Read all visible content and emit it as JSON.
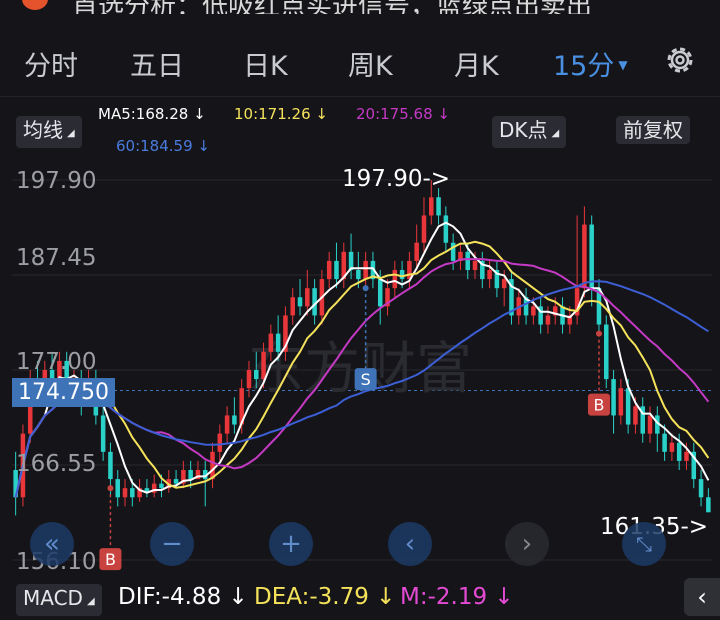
{
  "header": {
    "title": "首选分析：低吸红点买进信号，蓝绿点出卖出"
  },
  "tabs": [
    {
      "label": "分时"
    },
    {
      "label": "五日"
    },
    {
      "label": "日K"
    },
    {
      "label": "周K"
    },
    {
      "label": "月K"
    },
    {
      "label": "15分"
    }
  ],
  "indicator_bar": {
    "ma_selector": "均线",
    "ma5": "MA5:168.28",
    "ma10": "10:171.26",
    "ma20": "20:175.68",
    "ma60": "60:184.59",
    "arrow": "↓",
    "dk_selector": "DK点",
    "adjust": "前复权"
  },
  "colors": {
    "up": "#e8363b",
    "down": "#2ad1c9",
    "ma5": "#ffffff",
    "ma10": "#f5e25b",
    "ma20": "#c43ac4",
    "ma60": "#3c5fd6",
    "accent": "#4a90e2",
    "dif": "#ffffff",
    "dea": "#f5e25b",
    "m": "#e44bd4"
  },
  "y_axis": {
    "ticks": [
      "197.90",
      "187.45",
      "177.00",
      "166.55",
      "156.10"
    ]
  },
  "current_price_label": "174.750",
  "annotations": {
    "high": "197.90->",
    "low": "161.35->",
    "signal_s": "S",
    "signal_b": "B"
  },
  "watermark": "东方财富",
  "macd": {
    "selector": "MACD",
    "dif": "DIF:-4.88",
    "dea": "DEA:-3.79",
    "m": "M:-2.19",
    "arrow": "↓"
  },
  "chart_data": {
    "type": "candlestick",
    "ylim": [
      156.1,
      197.9
    ],
    "candles": [
      [
        166,
        163,
        168,
        161
      ],
      [
        163,
        170,
        171,
        162
      ],
      [
        170,
        176,
        177,
        169
      ],
      [
        176,
        174,
        178,
        173
      ],
      [
        174,
        177,
        178,
        173
      ],
      [
        177,
        176,
        179,
        175
      ],
      [
        176,
        178,
        179,
        175
      ],
      [
        178,
        175,
        179,
        174
      ],
      [
        175,
        176,
        177,
        173
      ],
      [
        176,
        174,
        177,
        172
      ],
      [
        174,
        176,
        177,
        173
      ],
      [
        176,
        172,
        177,
        171
      ],
      [
        172,
        168,
        173,
        167
      ],
      [
        168,
        165,
        169,
        163
      ],
      [
        165,
        163,
        166,
        162
      ],
      [
        163,
        164,
        165,
        162
      ],
      [
        164,
        163,
        165,
        162
      ],
      [
        163,
        164,
        165,
        162.5
      ],
      [
        164,
        163.5,
        165,
        163
      ],
      [
        163.5,
        164.5,
        165.5,
        163
      ],
      [
        164.5,
        164,
        165.5,
        163
      ],
      [
        164,
        165,
        166,
        163.5
      ],
      [
        165,
        164.5,
        166,
        164
      ],
      [
        164.5,
        166,
        167,
        164
      ],
      [
        166,
        165,
        167,
        164
      ],
      [
        165,
        166,
        167,
        165
      ],
      [
        166,
        165,
        167,
        162
      ],
      [
        165,
        168,
        169,
        164
      ],
      [
        168,
        170,
        171,
        167
      ],
      [
        170,
        172,
        173,
        169
      ],
      [
        172,
        171,
        174,
        170
      ],
      [
        171,
        175,
        176,
        170
      ],
      [
        175,
        177,
        178,
        174
      ],
      [
        177,
        176,
        179,
        175
      ],
      [
        176,
        179,
        180,
        175
      ],
      [
        179,
        181,
        182,
        178
      ],
      [
        181,
        179,
        183,
        178
      ],
      [
        179,
        183,
        184,
        178
      ],
      [
        183,
        185,
        186,
        182
      ],
      [
        185,
        184,
        187,
        183
      ],
      [
        184,
        186,
        188,
        183
      ],
      [
        186,
        183,
        187,
        182
      ],
      [
        183,
        187,
        188,
        182
      ],
      [
        187,
        189,
        190,
        186
      ],
      [
        189,
        187,
        191,
        186
      ],
      [
        187,
        190,
        191,
        186
      ],
      [
        190,
        188,
        192,
        187
      ],
      [
        188,
        187,
        190,
        186
      ],
      [
        187,
        189,
        190,
        186
      ],
      [
        189,
        187,
        190,
        186
      ],
      [
        187,
        184,
        188,
        182
      ],
      [
        184,
        186,
        187,
        183
      ],
      [
        186,
        188,
        189,
        185
      ],
      [
        188,
        187,
        189,
        186
      ],
      [
        187,
        189,
        190,
        186
      ],
      [
        189,
        191,
        193,
        188
      ],
      [
        191,
        194,
        196,
        190
      ],
      [
        194,
        196,
        197.9,
        193
      ],
      [
        196,
        194,
        197,
        193
      ],
      [
        194,
        191,
        195,
        190
      ],
      [
        191,
        189,
        192,
        188
      ],
      [
        189,
        190,
        191,
        188
      ],
      [
        190,
        188,
        191,
        187
      ],
      [
        188,
        189,
        190,
        187
      ],
      [
        189,
        187,
        190,
        186
      ],
      [
        187,
        188,
        189,
        186
      ],
      [
        188,
        186,
        189,
        185
      ],
      [
        186,
        187,
        188,
        184
      ],
      [
        187,
        183,
        188,
        182
      ],
      [
        183,
        185,
        186,
        182
      ],
      [
        185,
        183,
        186,
        182
      ],
      [
        183,
        184,
        185,
        182
      ],
      [
        184,
        182,
        185,
        181
      ],
      [
        182,
        183,
        184,
        181
      ],
      [
        183,
        184,
        185,
        182
      ],
      [
        184,
        182,
        185,
        181
      ],
      [
        182,
        183,
        184,
        181
      ],
      [
        183,
        186,
        194,
        182
      ],
      [
        186,
        193,
        195,
        185
      ],
      [
        193,
        186,
        194,
        184
      ],
      [
        186,
        182,
        187,
        181
      ],
      [
        182,
        176,
        183,
        175
      ],
      [
        176,
        172,
        177,
        170
      ],
      [
        172,
        175,
        176,
        171
      ],
      [
        175,
        171,
        176,
        170
      ],
      [
        171,
        173,
        174,
        170
      ],
      [
        173,
        170,
        174,
        169
      ],
      [
        170,
        172,
        173,
        169
      ],
      [
        172,
        170,
        173,
        168
      ],
      [
        170,
        168,
        171,
        167
      ],
      [
        168,
        169,
        170,
        167
      ],
      [
        169,
        167,
        170,
        166
      ],
      [
        167,
        168,
        169,
        166
      ],
      [
        168,
        165,
        169,
        164
      ],
      [
        165,
        163,
        166,
        162
      ],
      [
        163,
        161.35,
        164,
        161.35
      ]
    ]
  }
}
